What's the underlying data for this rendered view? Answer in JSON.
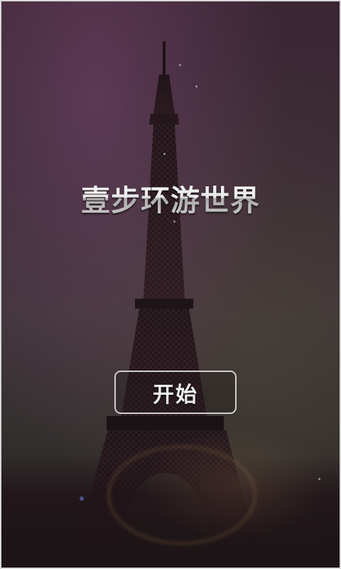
{
  "app": {
    "title": "壹步环游世界"
  },
  "actions": {
    "start_label": "开始"
  },
  "background": {
    "subject": "eiffel-tower-at-dusk"
  }
}
